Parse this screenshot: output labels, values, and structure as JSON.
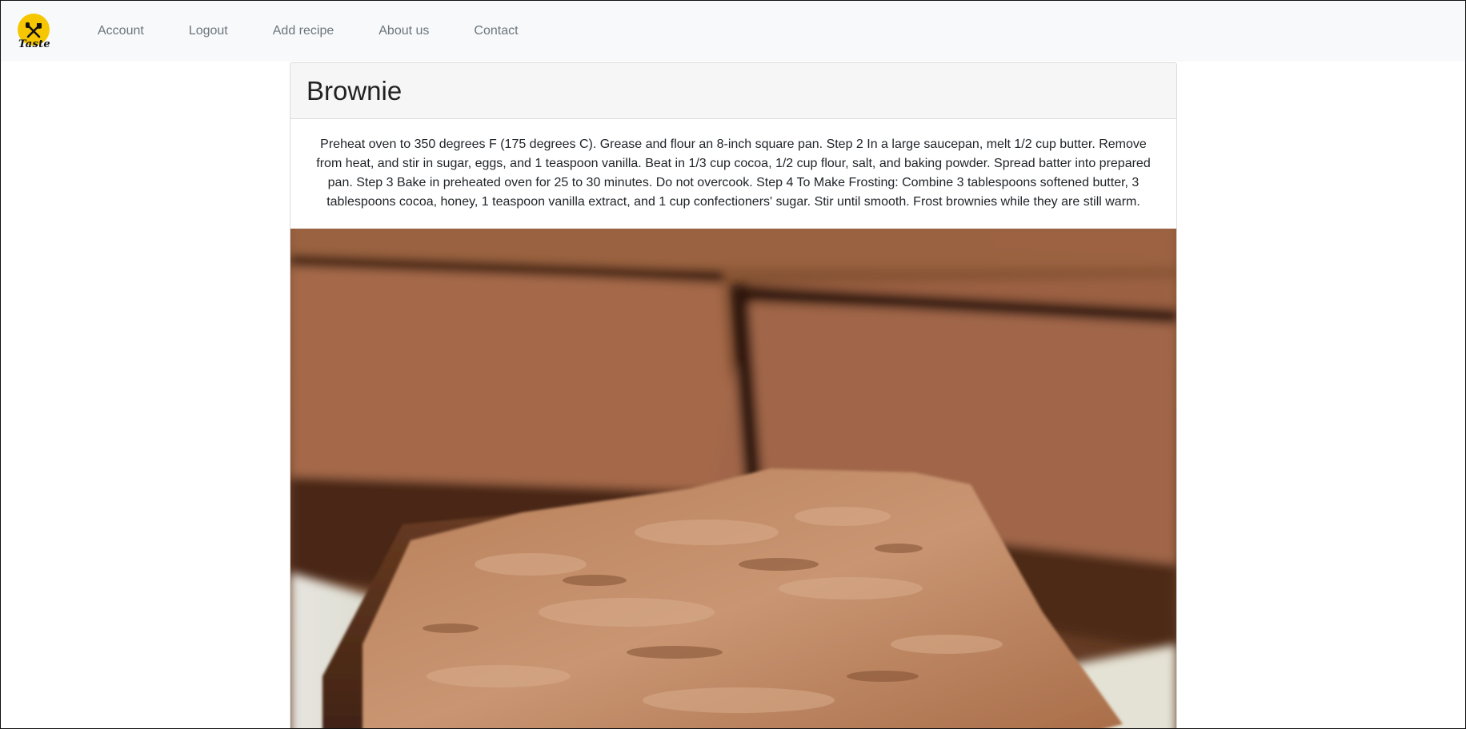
{
  "nav": {
    "logo_text": "Taste",
    "links": [
      "Account",
      "Logout",
      "Add recipe",
      "About us",
      "Contact"
    ]
  },
  "recipe": {
    "title": "Brownie",
    "description": "Preheat oven to 350 degrees F (175 degrees C). Grease and flour an 8-inch square pan. Step 2 In a large saucepan, melt 1/2 cup butter. Remove from heat, and stir in sugar, eggs, and 1 teaspoon vanilla. Beat in 1/3 cup cocoa, 1/2 cup flour, salt, and baking powder. Spread batter into prepared pan. Step 3 Bake in preheated oven for 25 to 30 minutes. Do not overcook. Step 4 To Make Frosting: Combine 3 tablespoons softened butter, 3 tablespoons cocoa, honey, 1 teaspoon vanilla extract, and 1 cup confectioners' sugar. Stir until smooth. Frost brownies while they are still warm."
  },
  "colors": {
    "brand_yellow": "#f6c700",
    "navbar_bg": "#f8f9fa",
    "nav_link": "#6c757d"
  },
  "icons": {
    "logo": "fork-knife-icon"
  }
}
